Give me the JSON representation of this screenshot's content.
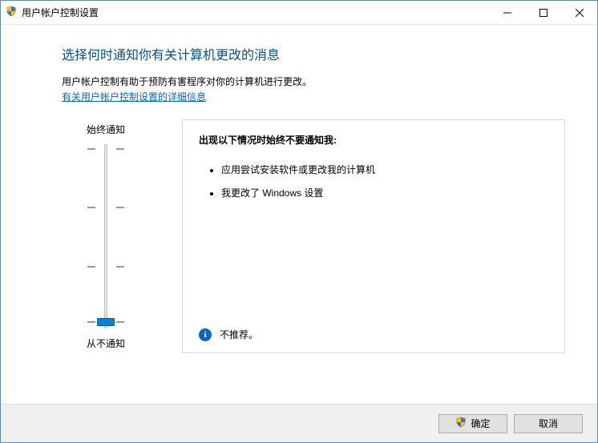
{
  "window": {
    "title": "用户帐户控制设置"
  },
  "heading": "选择何时通知你有关计算机更改的消息",
  "description": "用户帐户控制有助于预防有害程序对你的计算机进行更改。",
  "link": "有关用户帐户控制设置的详细信息",
  "slider": {
    "top_label": "始终通知",
    "bottom_label": "从不通知",
    "levels": 4,
    "current_level": 0
  },
  "panel": {
    "heading": "出现以下情况时始终不要通知我:",
    "bullets": [
      "应用尝试安装软件或更改我的计算机",
      "我更改了 Windows 设置"
    ],
    "recommendation": "不推荐。"
  },
  "footer": {
    "ok": "确定",
    "cancel": "取消"
  }
}
